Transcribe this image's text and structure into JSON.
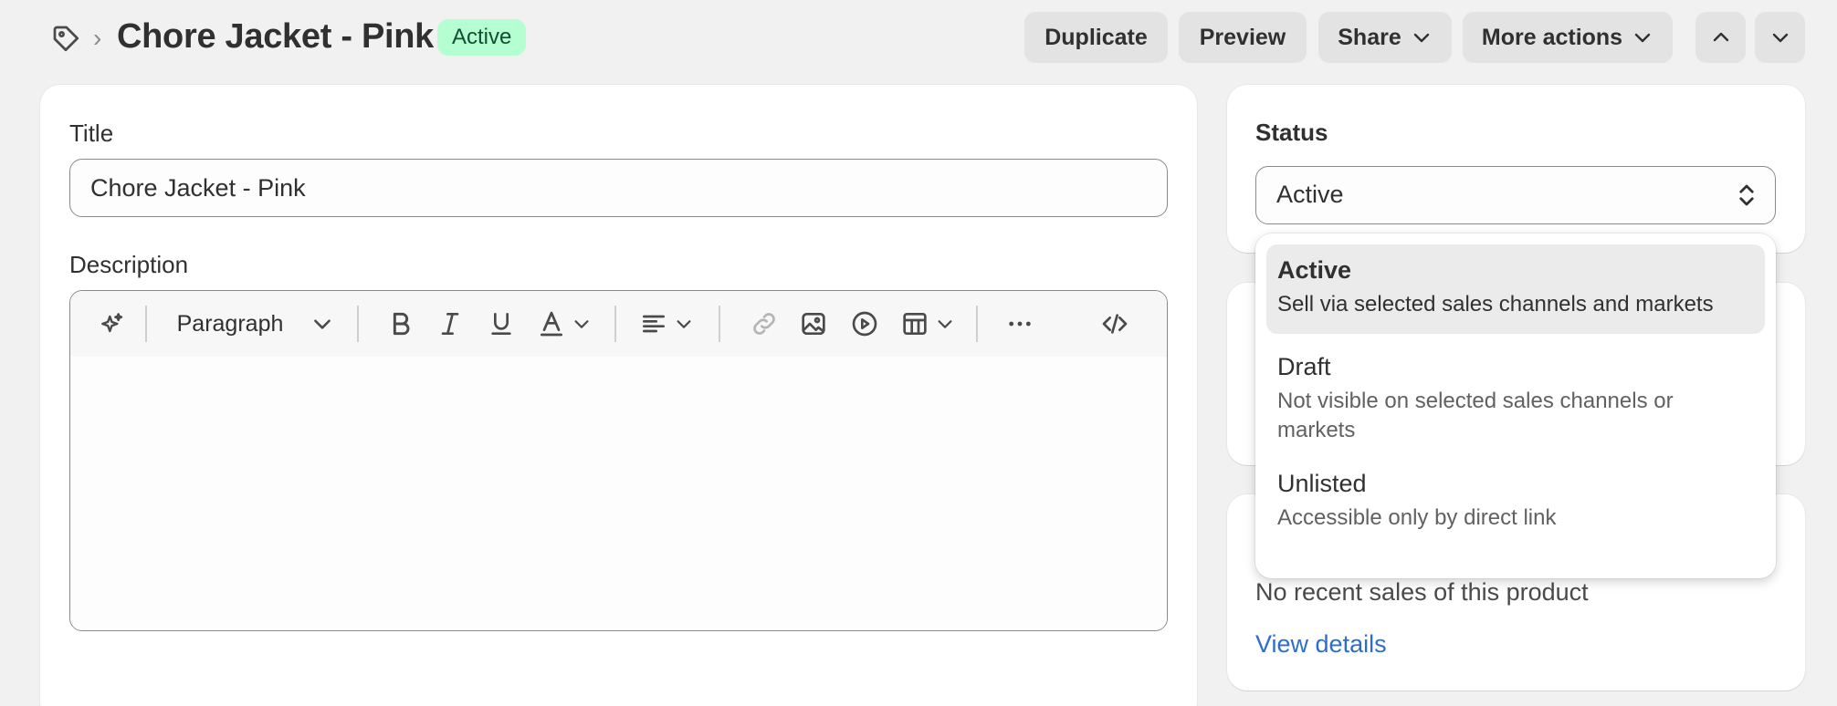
{
  "header": {
    "breadcrumb_separator": "›",
    "title": "Chore Jacket - Pink",
    "status_badge": "Active",
    "actions": {
      "duplicate": "Duplicate",
      "preview": "Preview",
      "share": "Share",
      "more": "More actions"
    }
  },
  "form": {
    "title_label": "Title",
    "title_value": "Chore Jacket - Pink",
    "description_label": "Description",
    "toolbar": {
      "format_select": "Paragraph"
    }
  },
  "status": {
    "label": "Status",
    "selected": "Active",
    "options": [
      {
        "title": "Active",
        "description": "Sell via selected sales channels and markets"
      },
      {
        "title": "Draft",
        "description": "Not visible on selected sales channels or markets"
      },
      {
        "title": "Unlisted",
        "description": "Accessible only by direct link"
      }
    ]
  },
  "sales": {
    "empty_text": "No recent sales of this product",
    "link": "View details"
  },
  "colors": {
    "badge_bg": "#b4fed2",
    "badge_text": "#0c5132",
    "link": "#2c6ecb",
    "page_bg": "#f1f1f1"
  }
}
